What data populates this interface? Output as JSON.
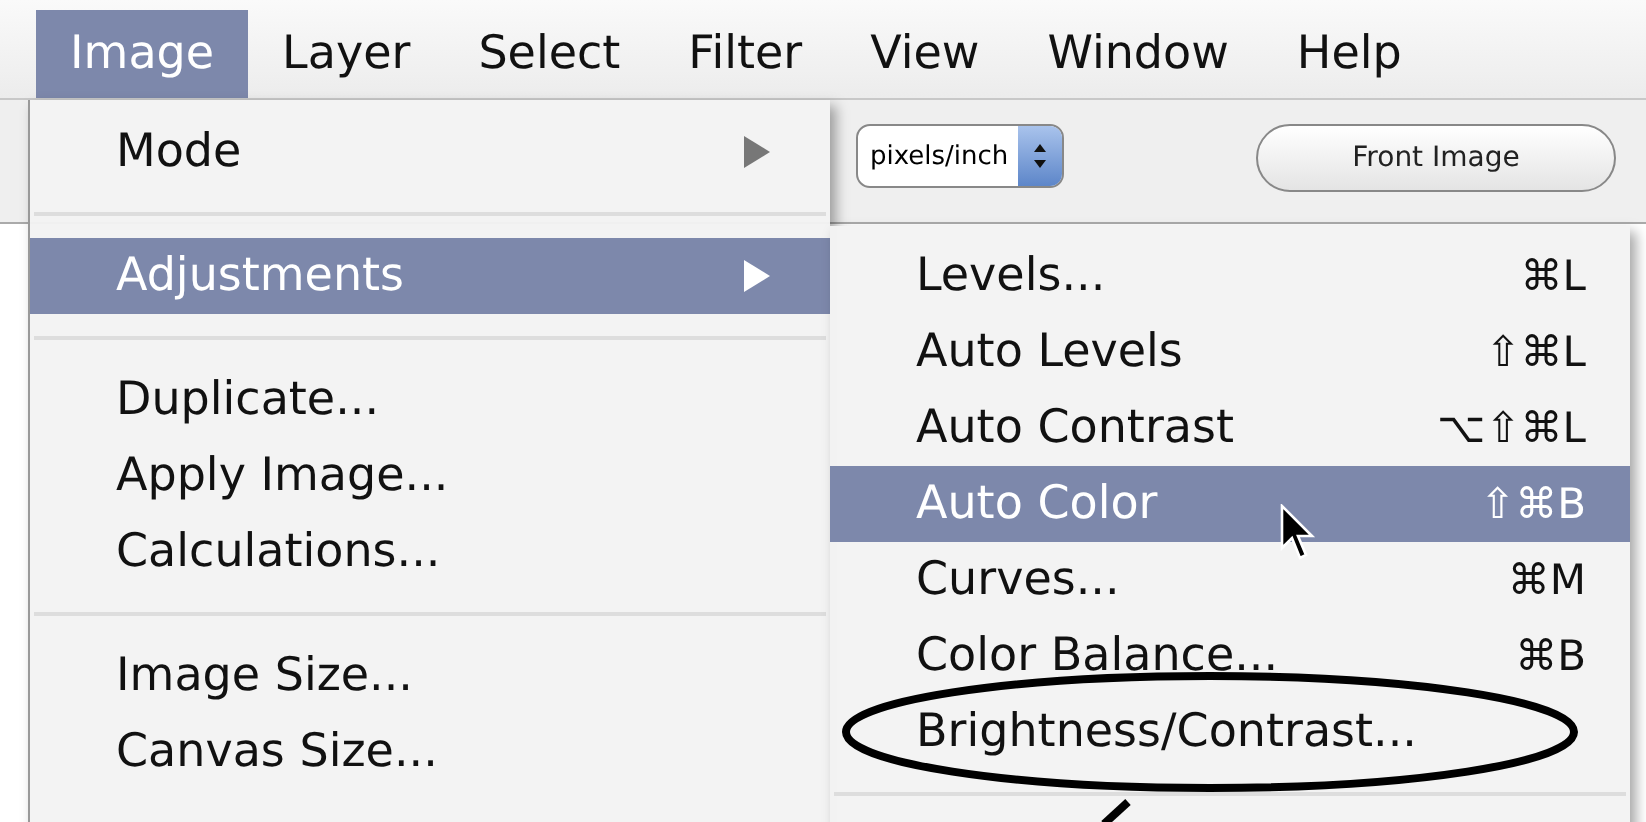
{
  "menubar": [
    {
      "label": "Image",
      "selected": true
    },
    {
      "label": "Layer",
      "selected": false
    },
    {
      "label": "Select",
      "selected": false
    },
    {
      "label": "Filter",
      "selected": false
    },
    {
      "label": "View",
      "selected": false
    },
    {
      "label": "Window",
      "selected": false
    },
    {
      "label": "Help",
      "selected": false
    }
  ],
  "toolbar": {
    "unit_select": "pixels/inch",
    "front_image_button": "Front Image"
  },
  "image_menu": {
    "items": [
      {
        "kind": "item",
        "label": "Mode",
        "submenu": true,
        "selected": false
      },
      {
        "kind": "separator"
      },
      {
        "kind": "item",
        "label": "Adjustments",
        "submenu": true,
        "selected": true
      },
      {
        "kind": "separator"
      },
      {
        "kind": "item",
        "label": "Duplicate...",
        "submenu": false,
        "selected": false
      },
      {
        "kind": "item",
        "label": "Apply Image...",
        "submenu": false,
        "selected": false
      },
      {
        "kind": "item",
        "label": "Calculations...",
        "submenu": false,
        "selected": false
      },
      {
        "kind": "separator"
      },
      {
        "kind": "item",
        "label": "Image Size...",
        "submenu": false,
        "selected": false
      },
      {
        "kind": "item",
        "label": "Canvas Size...",
        "submenu": false,
        "selected": false
      }
    ]
  },
  "adjustments_menu": {
    "items": [
      {
        "kind": "item",
        "label": "Levels...",
        "shortcut": "⌘L",
        "selected": false,
        "circled": false
      },
      {
        "kind": "item",
        "label": "Auto Levels",
        "shortcut": "⇧⌘L",
        "selected": false,
        "circled": false
      },
      {
        "kind": "item",
        "label": "Auto Contrast",
        "shortcut": "⌥⇧⌘L",
        "selected": false,
        "circled": false
      },
      {
        "kind": "item",
        "label": "Auto Color",
        "shortcut": "⇧⌘B",
        "selected": true,
        "circled": false
      },
      {
        "kind": "item",
        "label": "Curves...",
        "shortcut": "⌘M",
        "selected": false,
        "circled": false
      },
      {
        "kind": "item",
        "label": "Color Balance...",
        "shortcut": "⌘B",
        "selected": false,
        "circled": false
      },
      {
        "kind": "item",
        "label": "Brightness/Contrast...",
        "selected": false,
        "circled": true
      },
      {
        "kind": "separator"
      }
    ]
  }
}
